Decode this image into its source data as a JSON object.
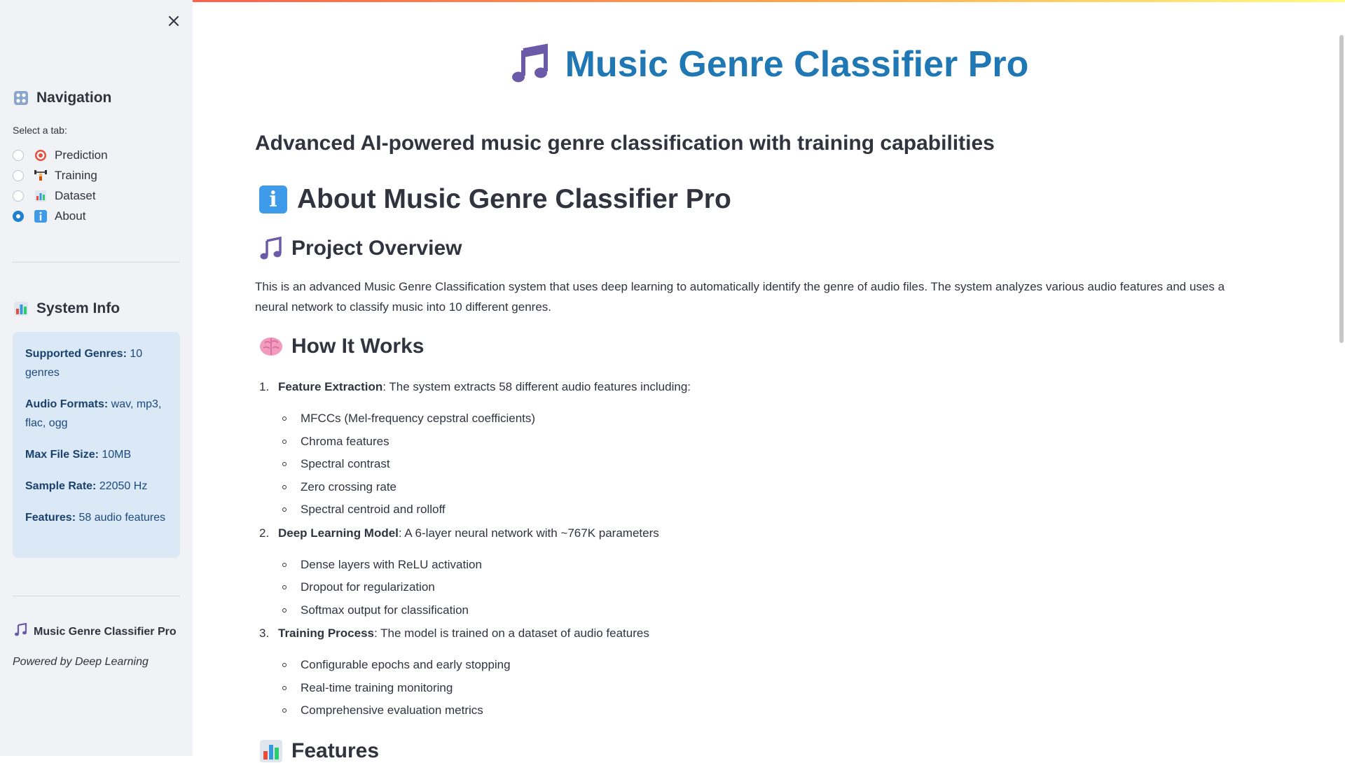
{
  "app": {
    "title": "Music Genre Classifier Pro"
  },
  "sidebar": {
    "navigation_heading": "Navigation",
    "select_label": "Select a tab:",
    "tabs": [
      {
        "label": "Prediction",
        "icon": "target-icon",
        "checked": false
      },
      {
        "label": "Training",
        "icon": "weightlifter-icon",
        "checked": false
      },
      {
        "label": "Dataset",
        "icon": "bar-chart-icon",
        "checked": false
      },
      {
        "label": "About",
        "icon": "info-icon",
        "checked": true
      }
    ],
    "system_info_heading": "System Info",
    "system_info": [
      {
        "label": "Supported Genres:",
        "value": "10 genres"
      },
      {
        "label": "Audio Formats:",
        "value": "wav, mp3, flac, ogg"
      },
      {
        "label": "Max File Size:",
        "value": "10MB"
      },
      {
        "label": "Sample Rate:",
        "value": "22050 Hz"
      },
      {
        "label": "Features:",
        "value": "58 audio features"
      }
    ],
    "footer_title": "Music Genre Classifier Pro",
    "footer_sub": "Powered by Deep Learning"
  },
  "main": {
    "title": "Music Genre Classifier Pro",
    "subtitle": "Advanced AI-powered music genre classification with training capabilities",
    "about_heading": "About Music Genre Classifier Pro",
    "overview_heading": "Project Overview",
    "overview_text": "This is an advanced Music Genre Classification system that uses deep learning to automatically identify the genre of audio files. The system analyzes various audio features and uses a neural network to classify music into 10 different genres.",
    "how_heading": "How It Works",
    "steps": [
      {
        "num": "1.",
        "title": "Feature Extraction",
        "text": ": The system extracts 58 different audio features including:",
        "bullets": [
          "MFCCs (Mel-frequency cepstral coefficients)",
          "Chroma features",
          "Spectral contrast",
          "Zero crossing rate",
          "Spectral centroid and rolloff"
        ]
      },
      {
        "num": "2.",
        "title": "Deep Learning Model",
        "text": ": A 6-layer neural network with ~767K parameters",
        "bullets": [
          "Dense layers with ReLU activation",
          "Dropout for regularization",
          "Softmax output for classification"
        ]
      },
      {
        "num": "3.",
        "title": "Training Process",
        "text": ": The model is trained on a dataset of audio features",
        "bullets": [
          "Configurable epochs and early stopping",
          "Real-time training monitoring",
          "Comprehensive evaluation metrics"
        ]
      }
    ],
    "features_heading": "Features"
  },
  "colors": {
    "title_blue": "#1f77b4",
    "radio_accent": "#1f7fd1",
    "info_card_bg": "#dbe8f5",
    "sidebar_bg": "#f0f2f6"
  }
}
